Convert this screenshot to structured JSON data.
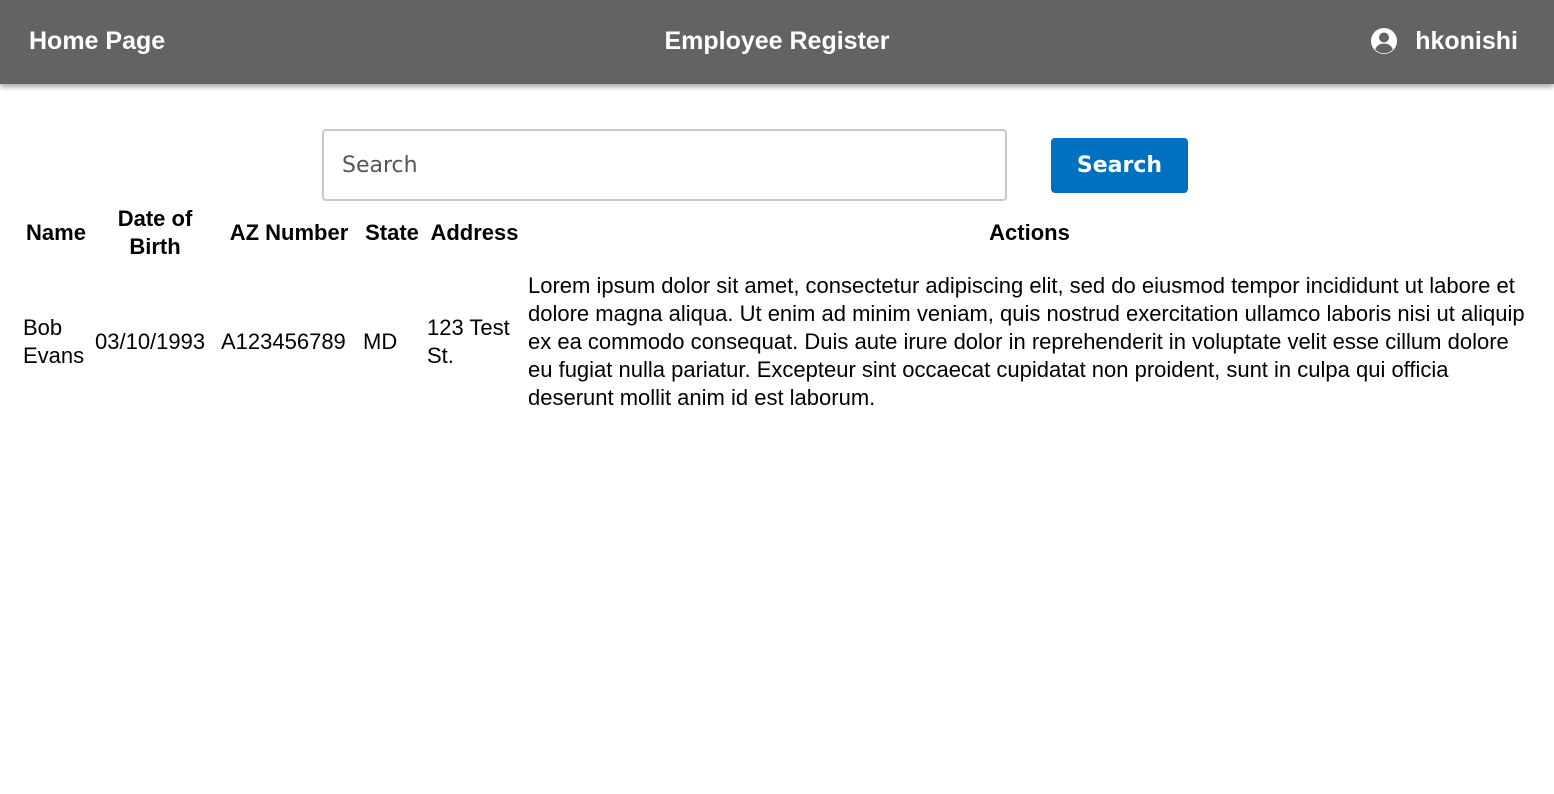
{
  "nav": {
    "home_label": "Home Page",
    "title": "Employee Register",
    "user_icon": "user-circle-icon",
    "username": "hkonishi",
    "background_color": "#636363"
  },
  "search": {
    "placeholder": "Search",
    "value": "",
    "button_label": "Search",
    "button_color": "#0070c0"
  },
  "table": {
    "columns": [
      "Name",
      "Date of Birth",
      "AZ Number",
      "State",
      "Address",
      "Actions"
    ],
    "rows": [
      {
        "name": "Bob Evans",
        "dob": "03/10/1993",
        "az_number": "A123456789",
        "state": "MD",
        "address": "123 Test St.",
        "actions": "Lorem ipsum dolor sit amet, consectetur adipiscing elit, sed do eiusmod tempor incididunt ut labore et dolore magna aliqua. Ut enim ad minim veniam, quis nostrud exercitation ullamco laboris nisi ut aliquip ex ea commodo consequat. Duis aute irure dolor in reprehenderit in voluptate velit esse cillum dolore eu fugiat nulla pariatur. Excepteur sint occaecat cupidatat non proident, sunt in culpa qui officia deserunt mollit anim id est laborum."
      }
    ]
  }
}
